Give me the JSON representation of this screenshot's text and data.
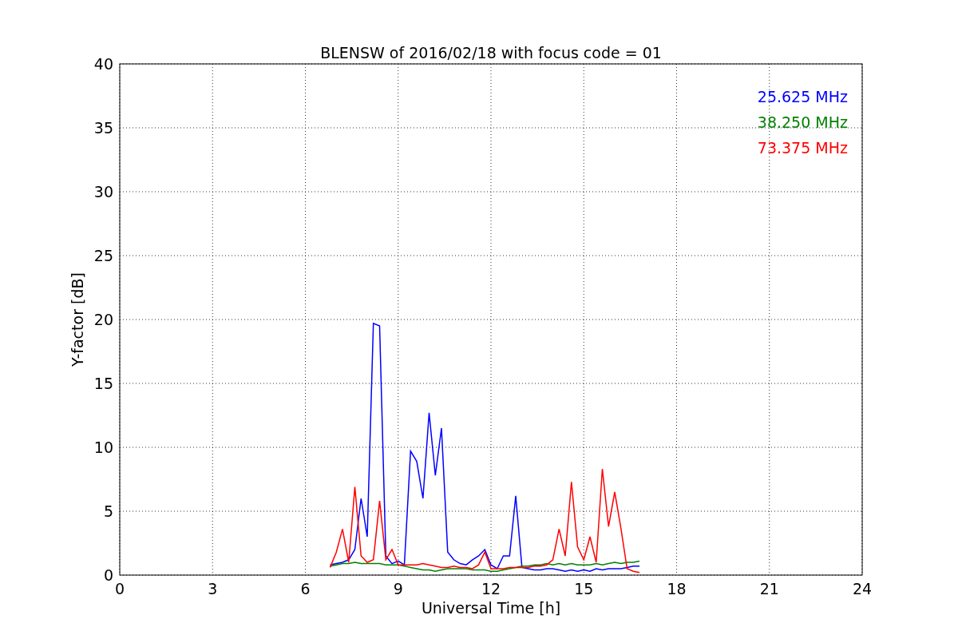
{
  "plot": {
    "chart_data": {
      "type": "line",
      "title": "BLENSW of 2016/02/18 with focus code = 01",
      "xlabel": "Universal Time [h]",
      "ylabel": "Y-factor [dB]",
      "x": [
        6.8,
        7.0,
        7.2,
        7.4,
        7.6,
        7.8,
        8.0,
        8.2,
        8.4,
        8.6,
        8.8,
        9.0,
        9.2,
        9.4,
        9.6,
        9.8,
        10.0,
        10.2,
        10.4,
        10.6,
        10.8,
        11.0,
        11.2,
        11.4,
        11.6,
        11.8,
        12.0,
        12.2,
        12.4,
        12.6,
        12.8,
        13.0,
        13.2,
        13.4,
        13.6,
        13.8,
        14.0,
        14.2,
        14.4,
        14.6,
        14.8,
        15.0,
        15.2,
        15.4,
        15.6,
        15.8,
        16.0,
        16.2,
        16.4,
        16.6,
        16.8
      ],
      "series": [
        {
          "name": "25.625 MHz",
          "color": "#0000ff",
          "values": [
            0.8,
            0.9,
            1.0,
            1.2,
            2.0,
            6.0,
            3.0,
            19.7,
            19.5,
            1.5,
            0.9,
            1.1,
            0.8,
            9.7,
            8.9,
            6.0,
            12.7,
            7.8,
            11.5,
            1.8,
            1.2,
            0.9,
            0.8,
            1.2,
            1.5,
            2.0,
            0.8,
            0.5,
            1.5,
            1.5,
            6.2,
            0.6,
            0.5,
            0.4,
            0.4,
            0.5,
            0.5,
            0.4,
            0.3,
            0.4,
            0.3,
            0.4,
            0.3,
            0.5,
            0.4,
            0.5,
            0.5,
            0.5,
            0.6,
            0.7,
            0.7
          ]
        },
        {
          "name": "38.250 MHz",
          "color": "#008000",
          "values": [
            0.7,
            0.8,
            0.9,
            0.9,
            1.0,
            0.9,
            0.9,
            0.9,
            0.9,
            0.8,
            0.8,
            0.8,
            0.7,
            0.6,
            0.5,
            0.4,
            0.4,
            0.3,
            0.4,
            0.5,
            0.5,
            0.5,
            0.5,
            0.4,
            0.4,
            0.4,
            0.3,
            0.3,
            0.4,
            0.5,
            0.6,
            0.7,
            0.7,
            0.8,
            0.8,
            0.9,
            0.8,
            0.9,
            0.8,
            0.9,
            0.8,
            0.8,
            0.8,
            0.9,
            0.8,
            0.9,
            1.0,
            0.9,
            1.0,
            1.0,
            1.1
          ]
        },
        {
          "name": "73.375 MHz",
          "color": "#ff0000",
          "values": [
            0.6,
            1.8,
            3.6,
            1.0,
            6.9,
            1.5,
            1.0,
            1.2,
            5.8,
            1.2,
            2.0,
            0.8,
            0.8,
            0.8,
            0.8,
            0.9,
            0.8,
            0.7,
            0.6,
            0.6,
            0.7,
            0.6,
            0.6,
            0.5,
            0.8,
            1.8,
            0.5,
            0.5,
            0.5,
            0.6,
            0.6,
            0.6,
            0.6,
            0.7,
            0.7,
            0.8,
            1.2,
            3.6,
            1.5,
            7.3,
            2.2,
            1.2,
            3.0,
            1.0,
            8.3,
            3.8,
            6.5,
            3.7,
            0.5,
            0.3,
            0.2
          ]
        }
      ],
      "xlim": [
        0,
        24
      ],
      "ylim": [
        0,
        40
      ],
      "xticks": [
        0,
        3,
        6,
        9,
        12,
        15,
        18,
        21,
        24
      ],
      "yticks": [
        0,
        5,
        10,
        15,
        20,
        25,
        30,
        35,
        40
      ],
      "grid": true
    }
  }
}
